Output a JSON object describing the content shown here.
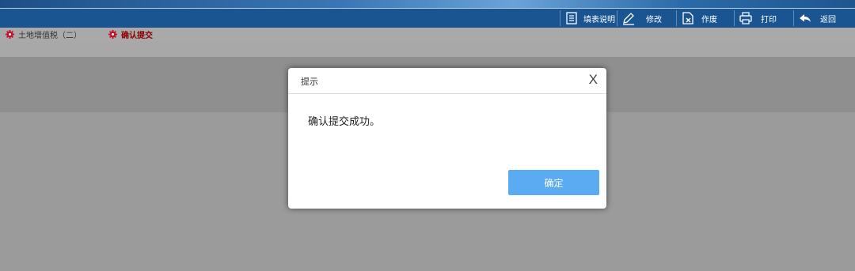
{
  "toolbar": {
    "items": [
      {
        "label": "填表说明",
        "icon": "document-icon"
      },
      {
        "label": "修改",
        "icon": "pencil-icon"
      },
      {
        "label": "作废",
        "icon": "void-document-icon"
      },
      {
        "label": "打印",
        "icon": "printer-icon"
      },
      {
        "label": "返回",
        "icon": "back-arrow-icon"
      }
    ]
  },
  "breadcrumb": {
    "items": [
      {
        "label": "土地增值税（二）",
        "icon": "gear-icon"
      },
      {
        "label": "确认提交",
        "icon": "gear-icon"
      }
    ]
  },
  "dialog": {
    "title": "提示",
    "close_label": "X",
    "message": "确认提交成功。",
    "ok_label": "确定"
  },
  "colors": {
    "toolbar_bg": "#1a5591",
    "ok_button": "#5aabf2",
    "active_crumb": "#8b0000",
    "gear_icon": "#c0142b"
  }
}
